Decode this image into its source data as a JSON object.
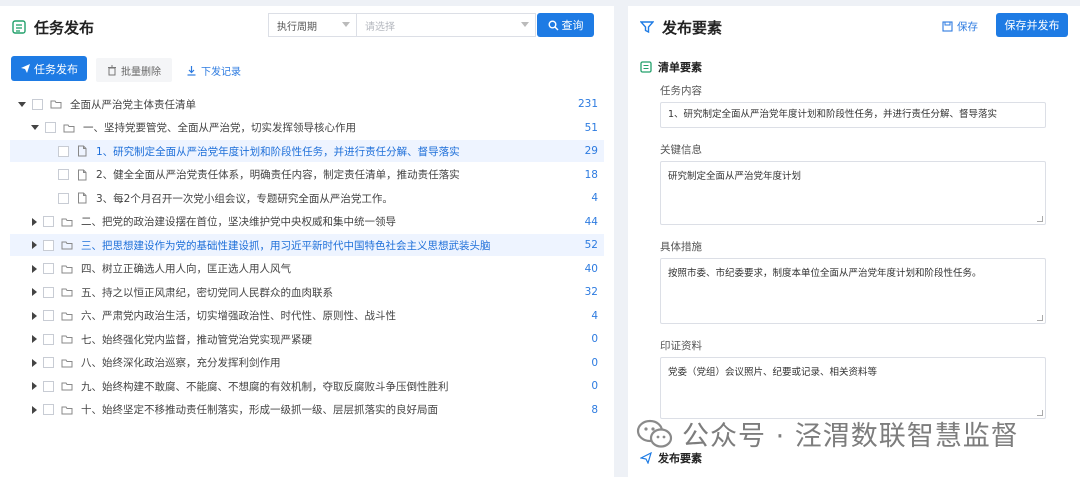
{
  "left": {
    "title": "任务发布",
    "filter": {
      "label": "执行周期",
      "placeholder": "请选择",
      "search_label": "查询"
    },
    "toolbar": {
      "publish": "任务发布",
      "batch_delete": "批量删除",
      "dispatch_log": "下发记录"
    },
    "tree": [
      {
        "level": 0,
        "expand": "down",
        "label": "全面从严治党主体责任清单",
        "count": "231",
        "icon": "folder",
        "hl": false
      },
      {
        "level": 1,
        "expand": "down",
        "label": "一、坚持党要管党、全面从严治党，切实发挥领导核心作用",
        "count": "51",
        "icon": "folder",
        "hl": false
      },
      {
        "level": 2,
        "expand": "none",
        "label": "1、研究制定全面从严治党年度计划和阶段性任务，并进行责任分解、督导落实",
        "count": "29",
        "icon": "doc",
        "hl": true
      },
      {
        "level": 2,
        "expand": "none",
        "label": "2、健全全面从严治党责任体系，明确责任内容，制定责任清单，推动责任落实",
        "count": "18",
        "icon": "doc",
        "hl": false
      },
      {
        "level": 2,
        "expand": "none",
        "label": "3、每2个月召开一次党小组会议，专题研究全面从严治党工作。",
        "count": "4",
        "icon": "doc",
        "hl": false
      },
      {
        "level": 1,
        "expand": "right",
        "label": "二、把党的政治建设摆在首位，坚决维护党中央权威和集中统一领导",
        "count": "44",
        "icon": "folder",
        "hl": false
      },
      {
        "level": 1,
        "expand": "right",
        "label": "三、把思想建设作为党的基础性建设抓，用习近平新时代中国特色社会主义思想武装头脑",
        "count": "52",
        "icon": "folder",
        "hl": true
      },
      {
        "level": 1,
        "expand": "right",
        "label": "四、树立正确选人用人向，匡正选人用人风气",
        "count": "40",
        "icon": "folder",
        "hl": false
      },
      {
        "level": 1,
        "expand": "right",
        "label": "五、持之以恒正风肃纪，密切党同人民群众的血肉联系",
        "count": "32",
        "icon": "folder",
        "hl": false
      },
      {
        "level": 1,
        "expand": "right",
        "label": "六、严肃党内政治生活，切实增强政治性、时代性、原则性、战斗性",
        "count": "4",
        "icon": "folder",
        "hl": false
      },
      {
        "level": 1,
        "expand": "right",
        "label": "七、始终强化党内监督，推动管党治党实现严紧硬",
        "count": "0",
        "icon": "folder",
        "hl": false
      },
      {
        "level": 1,
        "expand": "right",
        "label": "八、始终深化政治巡察，充分发挥利剑作用",
        "count": "0",
        "icon": "folder",
        "hl": false
      },
      {
        "level": 1,
        "expand": "right",
        "label": "九、始终构建不敢腐、不能腐、不想腐的有效机制，夺取反腐败斗争压倒性胜利",
        "count": "0",
        "icon": "folder",
        "hl": false
      },
      {
        "level": 1,
        "expand": "right",
        "label": "十、始终坚定不移推动责任制落实，形成一级抓一级、层层抓落实的良好局面",
        "count": "8",
        "icon": "folder",
        "hl": false
      }
    ]
  },
  "right": {
    "title": "发布要素",
    "save": "保存",
    "save_publish": "保存并发布",
    "section1": "清单要素",
    "fields": {
      "task_label": "任务内容",
      "task_value": "1、研究制定全面从严治党年度计划和阶段性任务，并进行责任分解、督导落实",
      "key_label": "关键信息",
      "key_value": "研究制定全面从严治党年度计划",
      "measure_label": "具体措施",
      "measure_value": "按照市委、市纪委要求，制度本单位全面从严治党年度计划和阶段性任务。",
      "evidence_label": "印证资料",
      "evidence_value": "党委（党组）会议照片、纪要或记录、相关资料等"
    },
    "section2": "发布要素"
  },
  "watermark": "公众号 · 泾渭数联智慧监督",
  "colors": {
    "accent": "#1e7be4",
    "count": "#2d7be0",
    "highlight_bg": "#eef4ff",
    "section_icon": "#22a06b"
  }
}
